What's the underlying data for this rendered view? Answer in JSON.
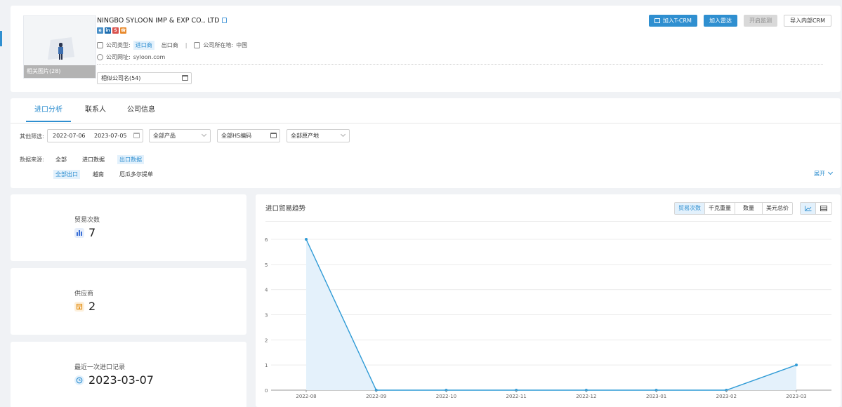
{
  "header": {
    "company_name": "NINGBO SYLOON IMP & EXP CO., LTD",
    "photo_label": "相关图片(28)",
    "socials": [
      {
        "name": "website-icon",
        "text": "e",
        "color": "#4a90c8"
      },
      {
        "name": "linkedin-icon",
        "text": "in",
        "color": "#1f6fb0"
      },
      {
        "name": "social-s-icon",
        "text": "S",
        "color": "#d9534f"
      },
      {
        "name": "phone-icon",
        "text": "☎",
        "color": "#e88a2d"
      }
    ],
    "company_type_label": "公司类型:",
    "company_type_active": "进口商",
    "company_type_other": "出口商",
    "location_label": "公司所在地:",
    "location_value": "中国",
    "website_label": "公司网址:",
    "website_value": "syloon.com",
    "similar_companies": "相似公司名(54)",
    "buttons": {
      "add_tcrm": "加入T-CRM",
      "add_radar": "加入雷达",
      "start_monitor": "开启监测",
      "import_crm": "导入内部CRM"
    }
  },
  "tabs": [
    "进口分析",
    "联系人",
    "公司信息"
  ],
  "filters": {
    "other_label": "其他筛选:",
    "date_start": "2022-07-06",
    "date_end": "2023-07-05",
    "product_placeholder": "全部产品",
    "hs_placeholder": "全部HS编码",
    "origin_placeholder": "全部原产地",
    "source_label": "数据来源:",
    "sources": [
      "全部",
      "进口数据",
      "出口数据"
    ],
    "sub_sources": [
      "全部出口",
      "越南",
      "厄瓜多尔提单"
    ],
    "expand": "展开"
  },
  "stats": [
    {
      "label": "贸易次数",
      "value": "7"
    },
    {
      "label": "供应商",
      "value": "2"
    },
    {
      "label": "最近一次进口记录",
      "value": "2023-03-07"
    }
  ],
  "chart_header": {
    "title": "进口贸易趋势",
    "metrics": [
      "贸易次数",
      "千克重量",
      "数量",
      "美元总价"
    ]
  },
  "chart_data": {
    "type": "area",
    "title": "进口贸易趋势",
    "categories": [
      "2022-08",
      "2022-09",
      "2022-10",
      "2022-11",
      "2022-12",
      "2023-01",
      "2023-02",
      "2023-03"
    ],
    "values": [
      6,
      0,
      0,
      0,
      0,
      0,
      0,
      1
    ],
    "ylim": [
      0,
      6
    ],
    "yticks": [
      0,
      1,
      2,
      3,
      4,
      5,
      6
    ],
    "grid": true,
    "color": "#2f9bd6"
  }
}
